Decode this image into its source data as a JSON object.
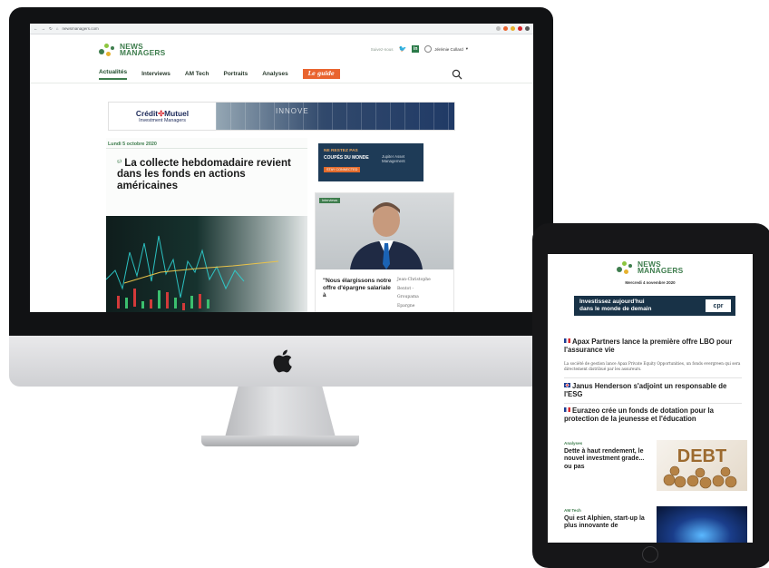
{
  "browser": {
    "url": "newsmanagers.com"
  },
  "site": {
    "logo_line1": "NEWS",
    "logo_line2": "MANAGERS",
    "suivez_label": "Suivez-nous",
    "twitter_glyph": "🐦",
    "linkedin_glyph": "in",
    "user_name": "Jérémie Collard",
    "nav": [
      {
        "label": "Actualités",
        "active": true
      },
      {
        "label": "Interviews"
      },
      {
        "label": "AM Tech"
      },
      {
        "label": "Portraits"
      },
      {
        "label": "Analyses"
      }
    ],
    "guide_label": "Le guide"
  },
  "banner": {
    "brand": "Crédit",
    "brand2": "Mutuel",
    "sub": "Investment Managers",
    "right_word": "INNOVE"
  },
  "main": {
    "date": "Lundi 5 octobre 2020",
    "headline": "La collecte hebdomadaire revient dans les fonds en actions américaines"
  },
  "side_ad": {
    "line1": "NE RESTEZ PAS",
    "line2": "COUPÉS DU MONDE",
    "cta": "STAY CONNECTED",
    "brand": "Jupiter Asset Management"
  },
  "interview": {
    "tag": "Interviews",
    "quote": "\"Nous élargissons notre offre d'épargne salariale à",
    "author_lines": [
      "Jean-Christophe",
      "Bentot -",
      "Groupama",
      "Epargne"
    ]
  },
  "tablet": {
    "date": "Mercredi 4 novembre 2020",
    "ad_line1": "Investissez aujourd'hui",
    "ad_line2": "dans le monde de demain",
    "ad_brand": "cpr",
    "items": [
      {
        "title": "Apax Partners lance la première offre LBO pour l'assurance vie",
        "flag": "fr"
      },
      {
        "title": "Janus Henderson s'adjoint un responsable de l'ESG",
        "flag": "uk"
      },
      {
        "title": "Eurazeo crée un fonds de dotation pour la protection de la jeunesse et l'éducation",
        "flag": "fr"
      }
    ],
    "item1_desc": "La société de gestion lance Apax Private Equity Opportunities, un fonds evergreen qui sera directement distribué par les assureurs.",
    "card1_cat": "Analyses",
    "card1_title": "Dette à haut rendement, le nouvel investment grade... ou pas",
    "card1_img_text": "DEBT",
    "card2_cat": "AM Tech",
    "card2_title": "Qui est Alphien, start-up la plus innovante de"
  }
}
